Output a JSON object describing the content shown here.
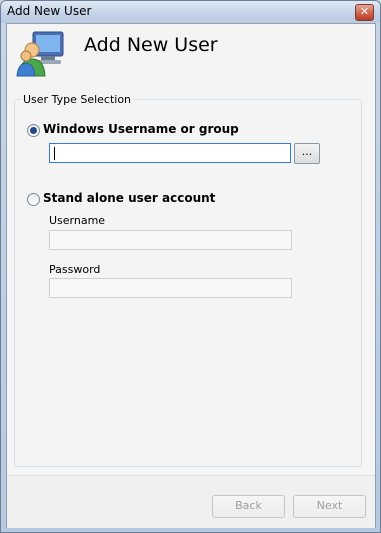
{
  "window": {
    "title": "Add New User",
    "close_glyph": "✕"
  },
  "header": {
    "title": "Add New User",
    "logo_icon": "users-computer-icon"
  },
  "group": {
    "legend": "User Type Selection",
    "windows_option": {
      "label": "Windows Username or group",
      "selected": true,
      "value": ""
    },
    "browse_label": "...",
    "standalone_option": {
      "label": "Stand alone user account",
      "selected": false
    },
    "username_label": "Username",
    "username_value": "",
    "password_label": "Password",
    "password_value": ""
  },
  "footer": {
    "back_label": "Back",
    "next_label": "Next"
  }
}
